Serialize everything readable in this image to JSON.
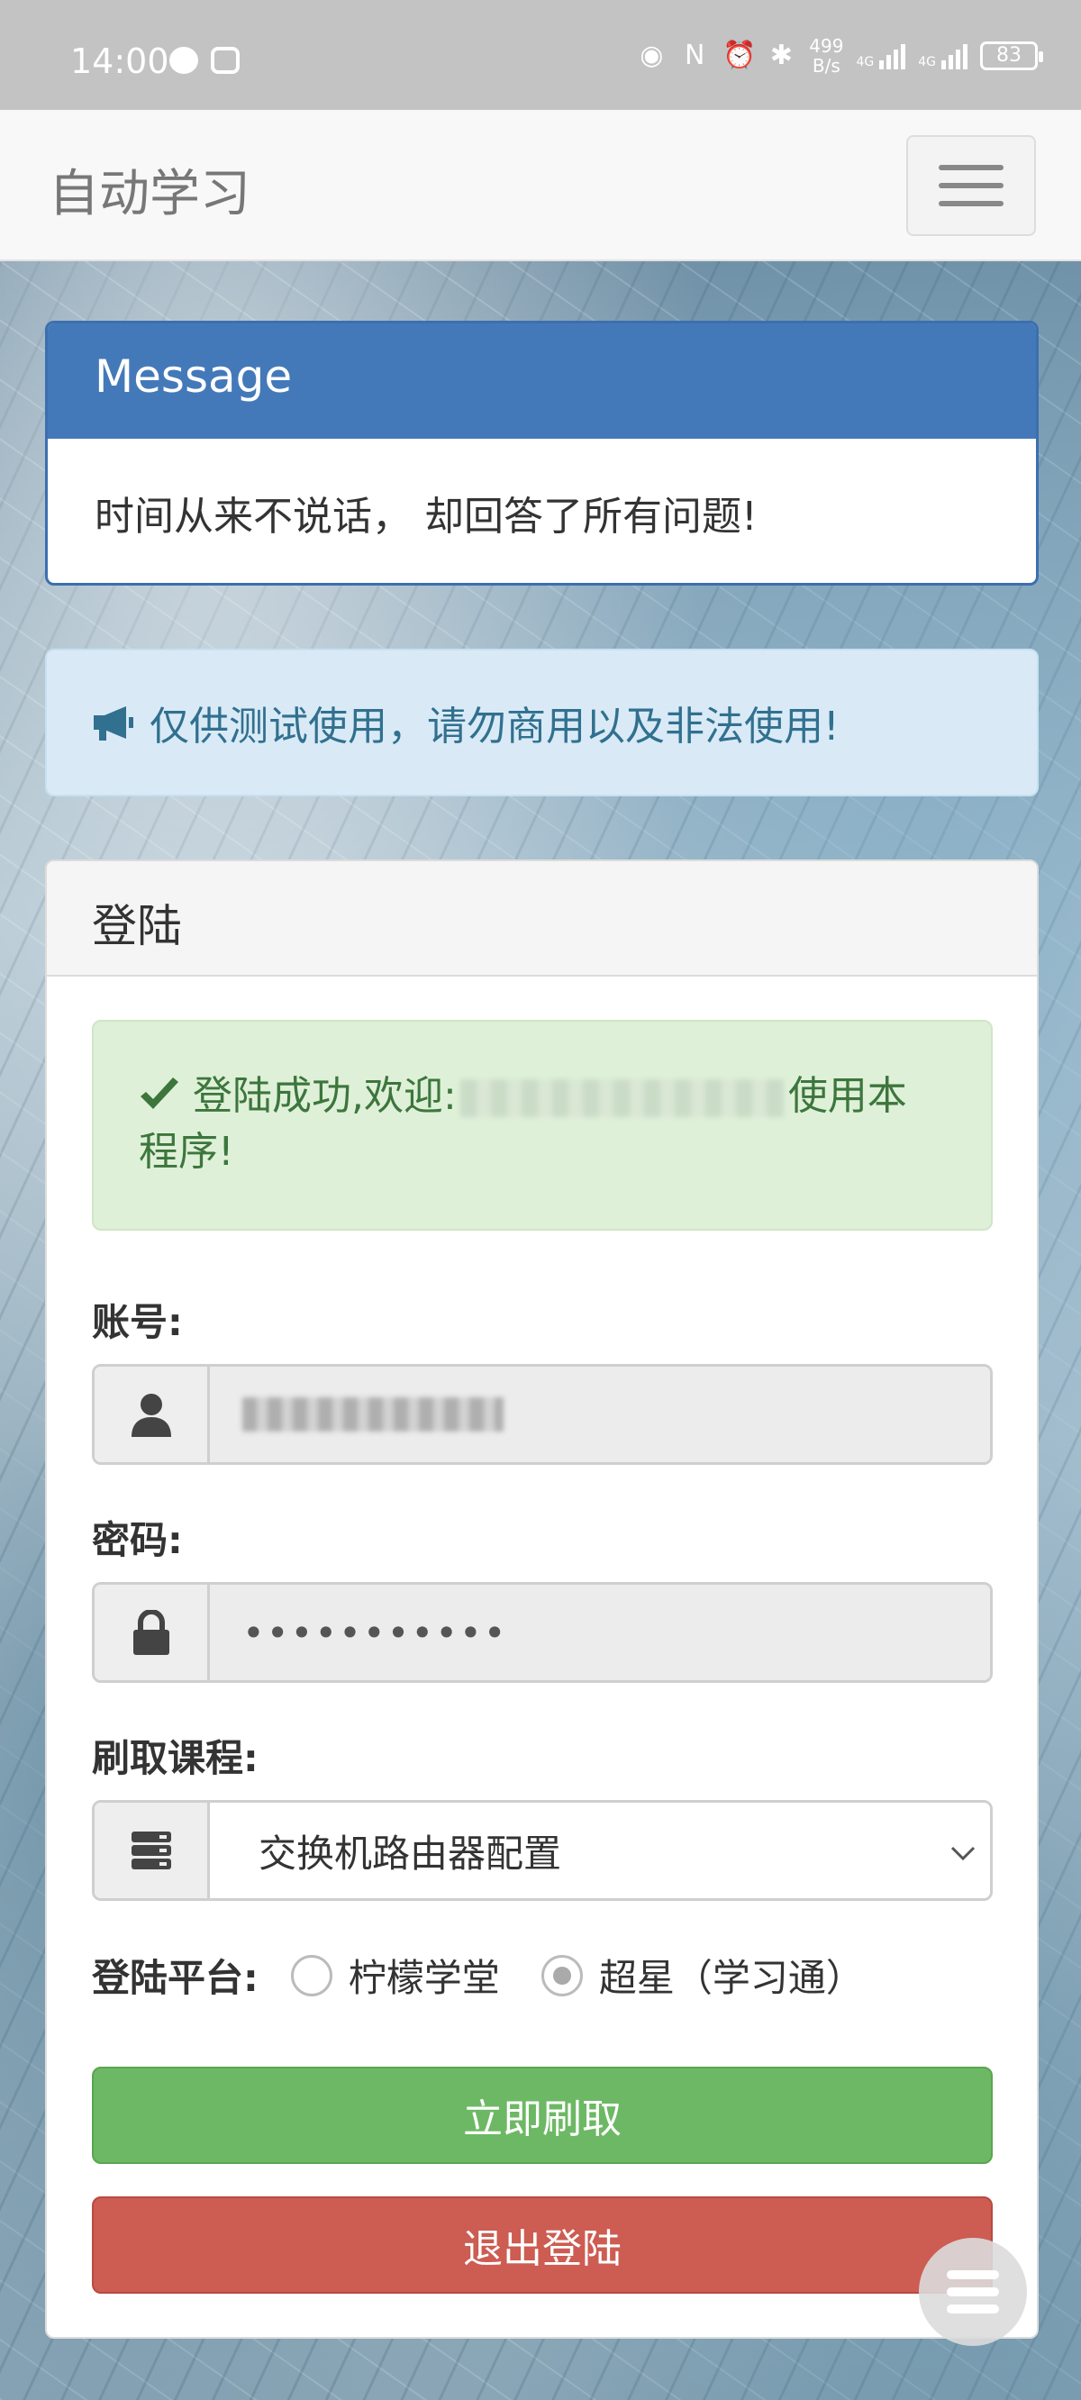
{
  "status_bar": {
    "time": "14:00",
    "net_rate_value": "499",
    "net_rate_unit": "B/s",
    "signal1_label": "4G",
    "signal2_label": "4G",
    "battery": "83"
  },
  "navbar": {
    "brand": "自动学习"
  },
  "message_panel": {
    "title": "Message",
    "body": "时间从来不说话， 却回答了所有问题!"
  },
  "info_alert": {
    "text": "仅供测试使用，请勿商用以及非法使用!"
  },
  "login_panel": {
    "title": "登陆",
    "success_prefix": "登陆成功,欢迎:",
    "success_suffix": "使用本程序!",
    "account_label": "账号:",
    "password_label": "密码:",
    "password_value": "•••••••••••",
    "course_label": "刷取课程:",
    "course_selected": "交换机路由器配置",
    "platform_label": "登陆平台:",
    "platform_options": [
      {
        "label": "柠檬学堂",
        "checked": false
      },
      {
        "label": "超星（学习通）",
        "checked": true
      }
    ],
    "submit_button": "立即刷取",
    "logout_button": "退出登陆"
  }
}
